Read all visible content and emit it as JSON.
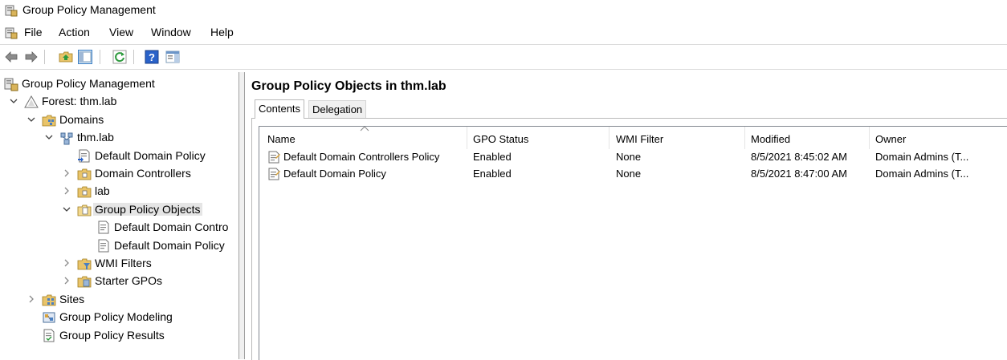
{
  "window": {
    "title": "Group Policy Management"
  },
  "menu": [
    "File",
    "Action",
    "View",
    "Window",
    "Help"
  ],
  "toolbar": [
    "back-icon",
    "forward-icon",
    "up-folder-icon",
    "show-hide-tree-icon",
    "refresh-icon",
    "help-icon",
    "action-pane-icon"
  ],
  "tree": [
    {
      "label": "Group Policy Management",
      "level": 0,
      "icon": "gpm-icon",
      "chevron": "none"
    },
    {
      "label": "Forest: thm.lab",
      "level": 1,
      "icon": "forest-icon",
      "chevron": "expanded"
    },
    {
      "label": "Domains",
      "level": 2,
      "icon": "domains-icon",
      "chevron": "expanded"
    },
    {
      "label": "thm.lab",
      "level": 3,
      "icon": "domain-icon",
      "chevron": "expanded"
    },
    {
      "label": "Default Domain Policy",
      "level": 4,
      "icon": "gpo-link-icon",
      "chevron": "none"
    },
    {
      "label": "Domain Controllers",
      "level": 4,
      "icon": "ou-folder-icon",
      "chevron": "collapsed"
    },
    {
      "label": "lab",
      "level": 4,
      "icon": "ou-folder-icon",
      "chevron": "collapsed"
    },
    {
      "label": "Group Policy Objects",
      "level": 4,
      "icon": "gpo-folder-icon",
      "chevron": "expanded",
      "selected": true
    },
    {
      "label": "Default Domain Contro",
      "level": 5,
      "icon": "gpo-icon",
      "chevron": "none"
    },
    {
      "label": "Default Domain Policy",
      "level": 5,
      "icon": "gpo-icon",
      "chevron": "none"
    },
    {
      "label": "WMI Filters",
      "level": 4,
      "icon": "wmi-folder-icon",
      "chevron": "collapsed"
    },
    {
      "label": "Starter GPOs",
      "level": 4,
      "icon": "starter-folder-icon",
      "chevron": "collapsed"
    },
    {
      "label": "Sites",
      "level": 2,
      "icon": "sites-icon",
      "chevron": "collapsed"
    },
    {
      "label": "Group Policy Modeling",
      "level": 2,
      "icon": "modeling-icon",
      "chevron": "none"
    },
    {
      "label": "Group Policy Results",
      "level": 2,
      "icon": "results-icon",
      "chevron": "none"
    }
  ],
  "content": {
    "title": "Group Policy Objects in thm.lab",
    "tabs": [
      {
        "label": "Contents",
        "active": true
      },
      {
        "label": "Delegation",
        "active": false
      }
    ],
    "columns": [
      "Name",
      "GPO Status",
      "WMI Filter",
      "Modified",
      "Owner"
    ],
    "rows": [
      [
        "Default Domain Controllers Policy",
        "Enabled",
        "None",
        "8/5/2021 8:45:02 AM",
        "Domain Admins (T..."
      ],
      [
        "Default Domain Policy",
        "Enabled",
        "None",
        "8/5/2021 8:47:00 AM",
        "Domain Admins (T..."
      ]
    ]
  }
}
